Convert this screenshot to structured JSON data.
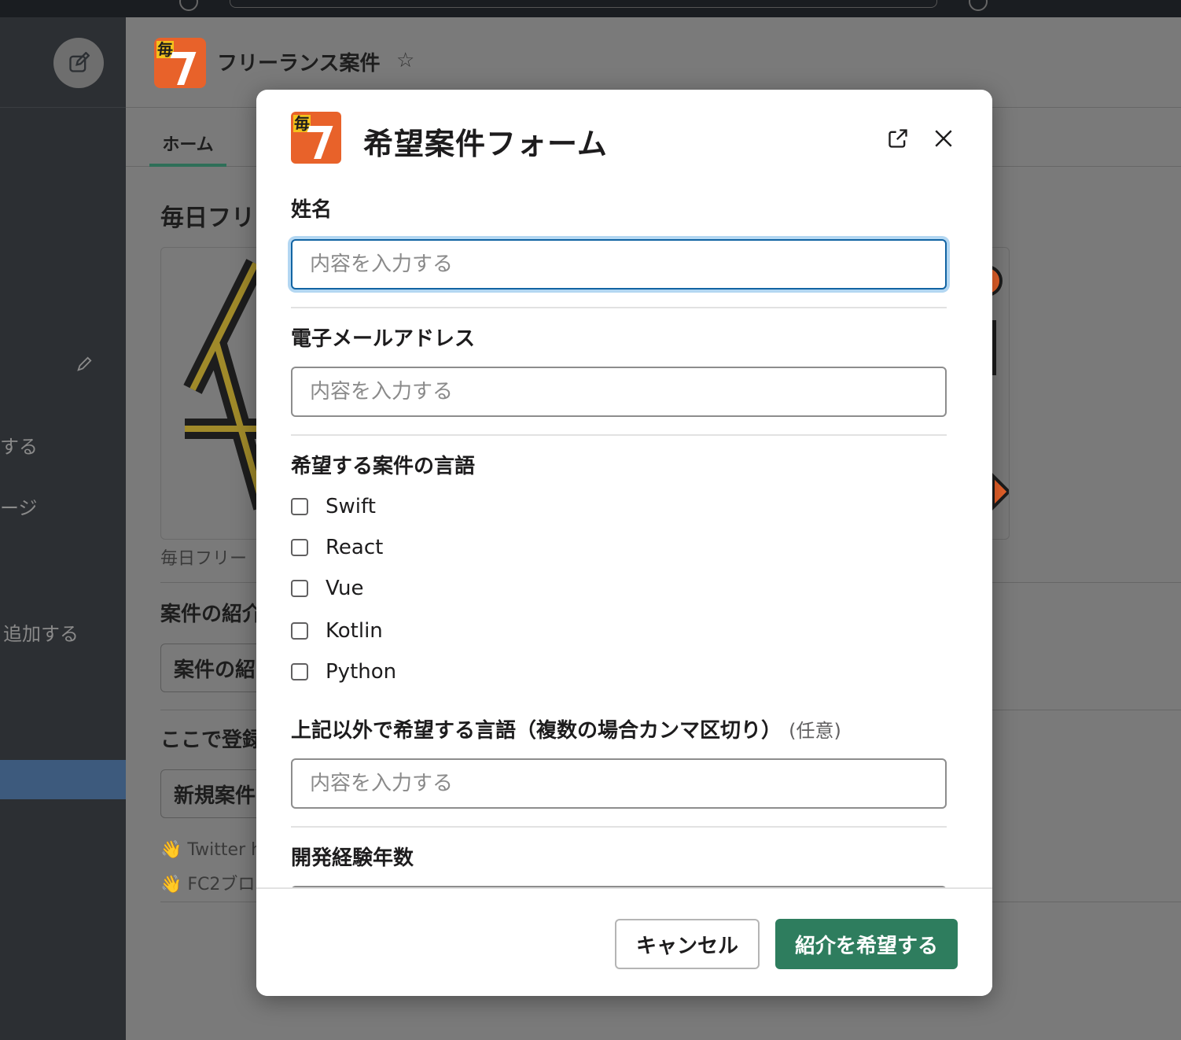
{
  "app": {
    "title": "フリーランス案件",
    "logo_char": "毎",
    "tab_home": "ホーム",
    "heading": "毎日フリ",
    "banner_caption": "毎日フリー",
    "section1_heading": "案件の紹介",
    "section1_button": "案件の紹",
    "section2_heading": "ここで登録",
    "section2_button": "新規案件",
    "links": [
      "👋 Twitter h",
      "👋 FC2ブロ"
    ]
  },
  "sidebar": {
    "items": [
      "する",
      "ージ",
      "追加する"
    ]
  },
  "modal": {
    "title": "希望案件フォーム",
    "fields": {
      "name": {
        "label": "姓名",
        "placeholder": "内容を入力する"
      },
      "email": {
        "label": "電子メールアドレス",
        "placeholder": "内容を入力する"
      },
      "languages": {
        "label": "希望する案件の言語",
        "options": [
          "Swift",
          "React",
          "Vue",
          "Kotlin",
          "Python"
        ]
      },
      "other_languages": {
        "label": "上記以外で希望する言語（複数の場合カンマ区切り）",
        "optional": "(任意)",
        "placeholder": "内容を入力する"
      },
      "experience": {
        "label": "開発経験年数"
      }
    },
    "buttons": {
      "cancel": "キャンセル",
      "submit": "紹介を希望する"
    }
  },
  "colors": {
    "submit_bg": "#2e7d5e",
    "focus_ring": "#1264a3",
    "logo_orange": "#e8622a"
  }
}
